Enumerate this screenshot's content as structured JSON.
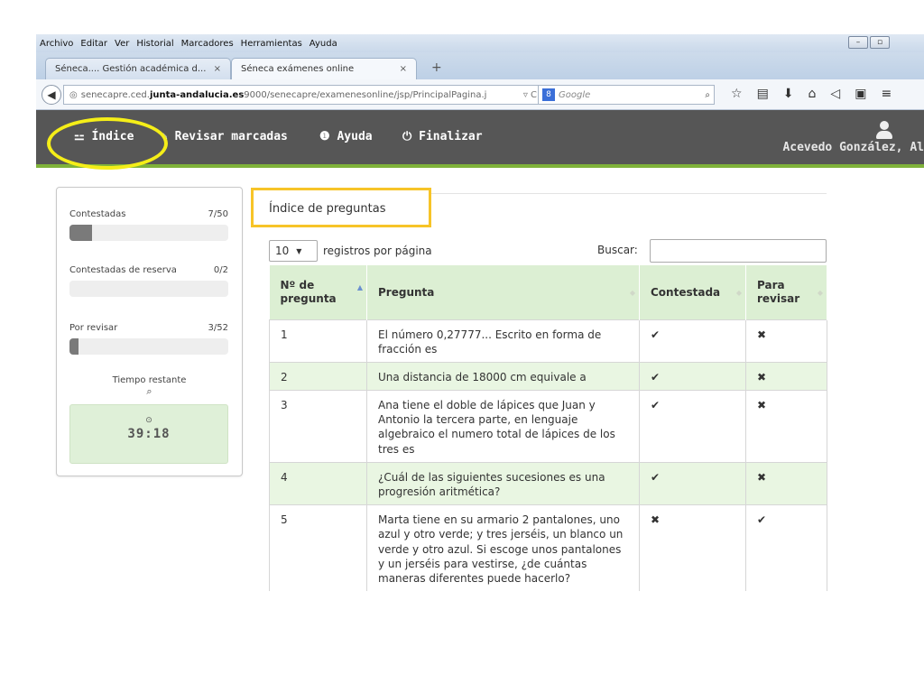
{
  "browser": {
    "menu": [
      "Archivo",
      "Editar",
      "Ver",
      "Historial",
      "Marcadores",
      "Herramientas",
      "Ayuda"
    ],
    "tabs": [
      {
        "title": "Séneca.... Gestión académica d...",
        "close": "×"
      },
      {
        "title": "Séneca exámenes online",
        "close": "×"
      }
    ],
    "new_tab": "+",
    "url_prefix": "senecapre.ced.",
    "url_domain": "junta-andalucia.es",
    "url_rest": "9000/senecapre/examenesonline/jsp/PrincipalPagina.j",
    "search_engine": "Google",
    "search_badge": "8"
  },
  "header": {
    "nav": [
      {
        "icon": "sitemap-icon",
        "label": "Índice"
      },
      {
        "icon": "pencil-icon",
        "label": "Revisar marcadas"
      },
      {
        "icon": "info-icon",
        "label": "Ayuda"
      },
      {
        "icon": "power-icon",
        "label": "Finalizar"
      }
    ],
    "user_name": "Acevedo González, Al",
    "accent": "#7fb23a"
  },
  "sidebar": {
    "stats": [
      {
        "label": "Contestadas",
        "value": "7/50",
        "progress": 0.14
      },
      {
        "label": "Contestadas de reserva",
        "value": "0/2",
        "progress": 0
      },
      {
        "label": "Por revisar",
        "value": "3/52",
        "progress": 0.058
      }
    ],
    "timer_label": "Tiempo restante",
    "timer_value": "39:18"
  },
  "main": {
    "title": "Índice de preguntas",
    "page_length": "10",
    "page_length_label": "registros por página",
    "search_label": "Buscar:",
    "search_value": "",
    "columns": [
      "Nº de pregunta",
      "Pregunta",
      "Contestada",
      "Para revisar"
    ],
    "rows": [
      {
        "n": "1",
        "q": "El número 0,27777... Escrito en forma de fracción es",
        "answered": "✔",
        "review": "✖"
      },
      {
        "n": "2",
        "q": "Una distancia de 18000 cm equivale a",
        "answered": "✔",
        "review": "✖"
      },
      {
        "n": "3",
        "q": "Ana tiene el doble de lápices que Juan y Antonio la tercera parte, en lenguaje algebraico el numero total de lápices de los tres es",
        "answered": "✔",
        "review": "✖"
      },
      {
        "n": "4",
        "q": "¿Cuál de las siguientes sucesiones es una progresión aritmética?",
        "answered": "✔",
        "review": "✖"
      },
      {
        "n": "5",
        "q": "Marta tiene en su armario 2 pantalones, uno azul y otro verde; y tres jerséis, un blanco un verde y otro azul. Si escoge unos pantalones y un jerséis para vestirse, ¿de cuántas maneras diferentes puede hacerlo?",
        "answered": "✖",
        "review": "✔"
      }
    ]
  }
}
